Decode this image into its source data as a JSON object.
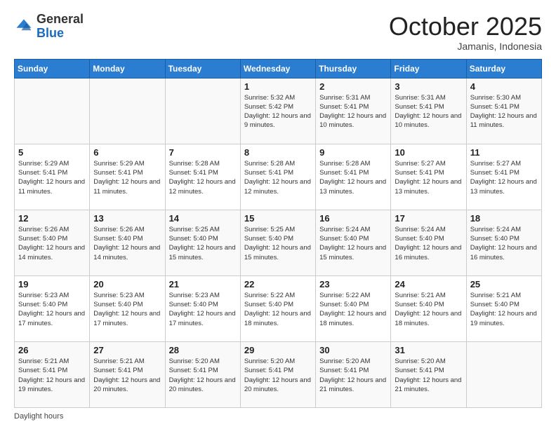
{
  "logo": {
    "general": "General",
    "blue": "Blue"
  },
  "header": {
    "month": "October 2025",
    "location": "Jamanis, Indonesia"
  },
  "weekdays": [
    "Sunday",
    "Monday",
    "Tuesday",
    "Wednesday",
    "Thursday",
    "Friday",
    "Saturday"
  ],
  "weeks": [
    [
      {
        "day": "",
        "sunrise": "",
        "sunset": "",
        "daylight": ""
      },
      {
        "day": "",
        "sunrise": "",
        "sunset": "",
        "daylight": ""
      },
      {
        "day": "",
        "sunrise": "",
        "sunset": "",
        "daylight": ""
      },
      {
        "day": "1",
        "sunrise": "Sunrise: 5:32 AM",
        "sunset": "Sunset: 5:42 PM",
        "daylight": "Daylight: 12 hours and 9 minutes."
      },
      {
        "day": "2",
        "sunrise": "Sunrise: 5:31 AM",
        "sunset": "Sunset: 5:41 PM",
        "daylight": "Daylight: 12 hours and 10 minutes."
      },
      {
        "day": "3",
        "sunrise": "Sunrise: 5:31 AM",
        "sunset": "Sunset: 5:41 PM",
        "daylight": "Daylight: 12 hours and 10 minutes."
      },
      {
        "day": "4",
        "sunrise": "Sunrise: 5:30 AM",
        "sunset": "Sunset: 5:41 PM",
        "daylight": "Daylight: 12 hours and 11 minutes."
      }
    ],
    [
      {
        "day": "5",
        "sunrise": "Sunrise: 5:29 AM",
        "sunset": "Sunset: 5:41 PM",
        "daylight": "Daylight: 12 hours and 11 minutes."
      },
      {
        "day": "6",
        "sunrise": "Sunrise: 5:29 AM",
        "sunset": "Sunset: 5:41 PM",
        "daylight": "Daylight: 12 hours and 11 minutes."
      },
      {
        "day": "7",
        "sunrise": "Sunrise: 5:28 AM",
        "sunset": "Sunset: 5:41 PM",
        "daylight": "Daylight: 12 hours and 12 minutes."
      },
      {
        "day": "8",
        "sunrise": "Sunrise: 5:28 AM",
        "sunset": "Sunset: 5:41 PM",
        "daylight": "Daylight: 12 hours and 12 minutes."
      },
      {
        "day": "9",
        "sunrise": "Sunrise: 5:28 AM",
        "sunset": "Sunset: 5:41 PM",
        "daylight": "Daylight: 12 hours and 13 minutes."
      },
      {
        "day": "10",
        "sunrise": "Sunrise: 5:27 AM",
        "sunset": "Sunset: 5:41 PM",
        "daylight": "Daylight: 12 hours and 13 minutes."
      },
      {
        "day": "11",
        "sunrise": "Sunrise: 5:27 AM",
        "sunset": "Sunset: 5:41 PM",
        "daylight": "Daylight: 12 hours and 13 minutes."
      }
    ],
    [
      {
        "day": "12",
        "sunrise": "Sunrise: 5:26 AM",
        "sunset": "Sunset: 5:40 PM",
        "daylight": "Daylight: 12 hours and 14 minutes."
      },
      {
        "day": "13",
        "sunrise": "Sunrise: 5:26 AM",
        "sunset": "Sunset: 5:40 PM",
        "daylight": "Daylight: 12 hours and 14 minutes."
      },
      {
        "day": "14",
        "sunrise": "Sunrise: 5:25 AM",
        "sunset": "Sunset: 5:40 PM",
        "daylight": "Daylight: 12 hours and 15 minutes."
      },
      {
        "day": "15",
        "sunrise": "Sunrise: 5:25 AM",
        "sunset": "Sunset: 5:40 PM",
        "daylight": "Daylight: 12 hours and 15 minutes."
      },
      {
        "day": "16",
        "sunrise": "Sunrise: 5:24 AM",
        "sunset": "Sunset: 5:40 PM",
        "daylight": "Daylight: 12 hours and 15 minutes."
      },
      {
        "day": "17",
        "sunrise": "Sunrise: 5:24 AM",
        "sunset": "Sunset: 5:40 PM",
        "daylight": "Daylight: 12 hours and 16 minutes."
      },
      {
        "day": "18",
        "sunrise": "Sunrise: 5:24 AM",
        "sunset": "Sunset: 5:40 PM",
        "daylight": "Daylight: 12 hours and 16 minutes."
      }
    ],
    [
      {
        "day": "19",
        "sunrise": "Sunrise: 5:23 AM",
        "sunset": "Sunset: 5:40 PM",
        "daylight": "Daylight: 12 hours and 17 minutes."
      },
      {
        "day": "20",
        "sunrise": "Sunrise: 5:23 AM",
        "sunset": "Sunset: 5:40 PM",
        "daylight": "Daylight: 12 hours and 17 minutes."
      },
      {
        "day": "21",
        "sunrise": "Sunrise: 5:23 AM",
        "sunset": "Sunset: 5:40 PM",
        "daylight": "Daylight: 12 hours and 17 minutes."
      },
      {
        "day": "22",
        "sunrise": "Sunrise: 5:22 AM",
        "sunset": "Sunset: 5:40 PM",
        "daylight": "Daylight: 12 hours and 18 minutes."
      },
      {
        "day": "23",
        "sunrise": "Sunrise: 5:22 AM",
        "sunset": "Sunset: 5:40 PM",
        "daylight": "Daylight: 12 hours and 18 minutes."
      },
      {
        "day": "24",
        "sunrise": "Sunrise: 5:21 AM",
        "sunset": "Sunset: 5:40 PM",
        "daylight": "Daylight: 12 hours and 18 minutes."
      },
      {
        "day": "25",
        "sunrise": "Sunrise: 5:21 AM",
        "sunset": "Sunset: 5:40 PM",
        "daylight": "Daylight: 12 hours and 19 minutes."
      }
    ],
    [
      {
        "day": "26",
        "sunrise": "Sunrise: 5:21 AM",
        "sunset": "Sunset: 5:41 PM",
        "daylight": "Daylight: 12 hours and 19 minutes."
      },
      {
        "day": "27",
        "sunrise": "Sunrise: 5:21 AM",
        "sunset": "Sunset: 5:41 PM",
        "daylight": "Daylight: 12 hours and 20 minutes."
      },
      {
        "day": "28",
        "sunrise": "Sunrise: 5:20 AM",
        "sunset": "Sunset: 5:41 PM",
        "daylight": "Daylight: 12 hours and 20 minutes."
      },
      {
        "day": "29",
        "sunrise": "Sunrise: 5:20 AM",
        "sunset": "Sunset: 5:41 PM",
        "daylight": "Daylight: 12 hours and 20 minutes."
      },
      {
        "day": "30",
        "sunrise": "Sunrise: 5:20 AM",
        "sunset": "Sunset: 5:41 PM",
        "daylight": "Daylight: 12 hours and 21 minutes."
      },
      {
        "day": "31",
        "sunrise": "Sunrise: 5:20 AM",
        "sunset": "Sunset: 5:41 PM",
        "daylight": "Daylight: 12 hours and 21 minutes."
      },
      {
        "day": "",
        "sunrise": "",
        "sunset": "",
        "daylight": ""
      }
    ]
  ],
  "footer": {
    "daylight_label": "Daylight hours"
  }
}
